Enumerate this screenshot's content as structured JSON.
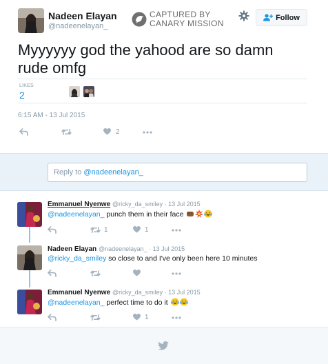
{
  "tweet": {
    "author_name": "Nadeen Elayan",
    "author_handle": "@nadeenelayan_",
    "text": "Myyyyyy god the yahood are so damn rude omfg",
    "likes_label": "LIKES",
    "likes_count": "2",
    "timestamp": "6:15 AM - 13 Jul 2015",
    "action_like_count": "2"
  },
  "watermark": {
    "line1": "CAPTURED BY",
    "line2": "CANARY MISSION"
  },
  "follow_button": {
    "label": "Follow"
  },
  "reply_box": {
    "prefix": "Reply to ",
    "mention": "@nadeenelayan_"
  },
  "replies": [
    {
      "name": "Emmanuel Nyenwe",
      "handle": "@ricky_da_smiley",
      "date": "13 Jul 2015",
      "mention": "@nadeenelayan_",
      "text": " punch them in their face",
      "retweets": "1",
      "likes": "1"
    },
    {
      "name": "Nadeen Elayan",
      "handle": "@nadeenelayan_",
      "date": "13 Jul 2015",
      "mention": "@ricky_da_smiley",
      "text": " so close to and I've only been here 10 minutes",
      "retweets": "",
      "likes": ""
    },
    {
      "name": "Emmanuel Nyenwe",
      "handle": "@ricky_da_smiley",
      "date": "13 Jul 2015",
      "mention": "@nadeenelayan_",
      "text": " perfect time to do it",
      "retweets": "",
      "likes": "1"
    }
  ],
  "separator": " · ",
  "colors": {
    "link": "#1b95e0",
    "muted": "#8899a6",
    "reply_bar": "#e9f2f8",
    "thread_line": "#8ec5e6"
  },
  "icons": [
    "gear-icon",
    "follow-person-icon",
    "reply-icon",
    "retweet-icon",
    "heart-icon",
    "more-icon",
    "twitter-bird-icon",
    "canary-mission-logo"
  ]
}
